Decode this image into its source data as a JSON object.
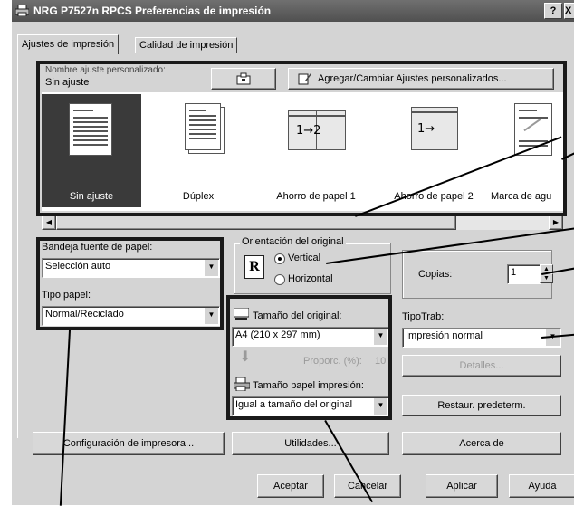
{
  "window": {
    "title": "NRG P7527n RPCS Preferencias de impresión",
    "help_label": "?",
    "close_label": "X"
  },
  "tabs": [
    {
      "label": "Ajustes de impresión"
    },
    {
      "label": "Calidad de impresión"
    }
  ],
  "custom_settings": {
    "name_label": "Nombre ajuste personalizado:",
    "name_value": "Sin ajuste",
    "add_change_label": "Agregar/Cambiar Ajustes personalizados..."
  },
  "presets": [
    {
      "label": "Sin ajuste",
      "selected": true,
      "icon": "single-page-icon"
    },
    {
      "label": "Dúplex",
      "icon": "duplex-icon"
    },
    {
      "label": "Ahorro de papel 1",
      "icon": "two-up-icon",
      "diagram": "1→2"
    },
    {
      "label": "Ahorro de papel 2",
      "icon": "two-up-duplex-icon",
      "diagram": "1→"
    },
    {
      "label": "Marca de agu",
      "icon": "watermark-icon"
    }
  ],
  "paper_source": {
    "label": "Bandeja fuente de papel:",
    "value": "Selección auto"
  },
  "paper_type": {
    "label": "Tipo papel:",
    "value": "Normal/Reciclado"
  },
  "orientation": {
    "legend": "Orientación del original",
    "vertical": "Vertical",
    "horizontal": "Horizontal",
    "icon_letter": "R",
    "selected": "vertical"
  },
  "copies": {
    "label": "Copias:",
    "value": "1"
  },
  "original_size": {
    "label": "Tamaño del original:",
    "value": "A4 (210 x 297 mm)"
  },
  "ratio": {
    "label": "Proporc. (%):",
    "value": "10"
  },
  "print_size": {
    "label": "Tamaño papel impresión:",
    "value": "Igual a tamaño del original"
  },
  "job_type": {
    "label": "TipoTrab:",
    "value": "Impresión normal",
    "details_label": "Detalles..."
  },
  "restore_label": "Restaur. predeterm.",
  "bottom_row": {
    "printer_config": "Configuración de impresora...",
    "utilities": "Utilidades...",
    "about": "Acerca de"
  },
  "dialog_buttons": {
    "ok": "Aceptar",
    "cancel": "Cancelar",
    "apply": "Aplicar",
    "help": "Ayuda"
  }
}
